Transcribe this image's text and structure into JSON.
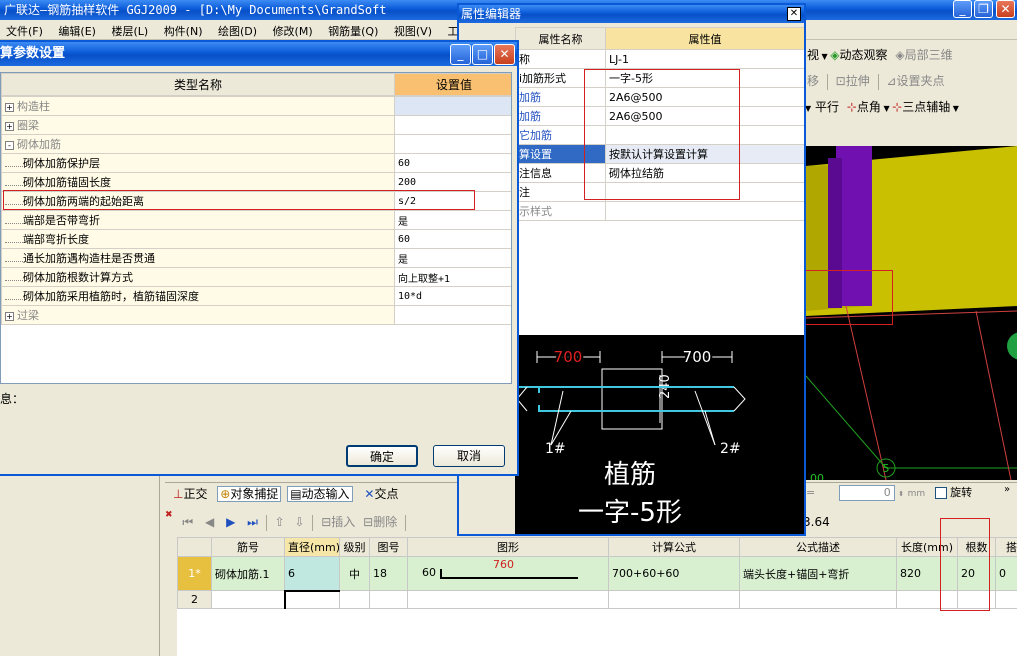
{
  "app": {
    "title": "广联达—钢筋抽样软件 GGJ2009 - [D:\\My Documents\\GrandSoft",
    "menus": [
      "文件(F)",
      "编辑(E)",
      "楼层(L)",
      "构件(N)",
      "绘图(D)",
      "修改(M)",
      "钢筋量(Q)",
      "视图(V)",
      "工具"
    ]
  },
  "toolbar_right": {
    "row1": [
      "视",
      "动态观察",
      "局部三维"
    ],
    "row2": [
      "移",
      "拉伸",
      "设置夹点"
    ],
    "row3": [
      "平行",
      "点角",
      "三点辅轴"
    ]
  },
  "calc_dialog": {
    "title": "算参数设置",
    "headers": {
      "name": "类型名称",
      "value": "设置值"
    },
    "rows": [
      {
        "expander": "+",
        "name": "构造柱",
        "value": "",
        "group": true
      },
      {
        "expander": "+",
        "name": "圈梁",
        "value": "",
        "group": true
      },
      {
        "expander": "-",
        "name": "砌体加筋",
        "value": "",
        "group": true
      },
      {
        "expander": "",
        "name": "砌体加筋保护层",
        "value": "60",
        "group": false
      },
      {
        "expander": "",
        "name": "砌体加筋锚固长度",
        "value": "200",
        "group": false
      },
      {
        "expander": "",
        "name": "砌体加筋两端的起始距离",
        "value": "s/2",
        "group": false
      },
      {
        "expander": "",
        "name": "端部是否带弯折",
        "value": "是",
        "group": false
      },
      {
        "expander": "",
        "name": "端部弯折长度",
        "value": "60",
        "group": false
      },
      {
        "expander": "",
        "name": "通长加筋遇构造柱是否贯通",
        "value": "是",
        "group": false
      },
      {
        "expander": "",
        "name": "砌体加筋根数计算方式",
        "value": "向上取整+1",
        "group": false
      },
      {
        "expander": "",
        "name": "砌体加筋采用植筋时，植筋锚固深度",
        "value": "10*d",
        "group": false
      },
      {
        "expander": "+",
        "name": "过梁",
        "value": "",
        "group": true
      }
    ],
    "info_label": "息：",
    "ok": "确定",
    "cancel": "取消"
  },
  "prop_editor": {
    "title": "属性编辑器",
    "headers": {
      "name": "属性名称",
      "value": "属性值"
    },
    "rows": [
      {
        "name": "称",
        "value": "LJ-1"
      },
      {
        "name": "i加筋形式",
        "value": "一字-5形"
      },
      {
        "name": "加筋",
        "value": "2A6@500"
      },
      {
        "name": "加筋",
        "value": "2A6@500"
      },
      {
        "name": "它加筋",
        "value": ""
      },
      {
        "name": "算设置",
        "value": "按默认计算设置计算"
      },
      {
        "name": "注信息",
        "value": "砌体拉结筋"
      },
      {
        "name": "注",
        "value": ""
      },
      {
        "name": "示样式",
        "value": ""
      }
    ]
  },
  "diagram": {
    "dim_left": "700",
    "dim_right": "700",
    "wall": "240",
    "label1": "1#",
    "label2": "2#",
    "caption1": "植筋",
    "caption2": "一字-5形"
  },
  "bottom_toolbar": {
    "ortho": "正交",
    "snap": "对象捕捉",
    "dyn": "动态输入",
    "intersect": "交点",
    "rotate_value": "0",
    "rotate_unit": "mm",
    "rotate": "旋转",
    "insert": "插入",
    "delete": "删除",
    "len": "3.64"
  },
  "rebar_table": {
    "headers": [
      "",
      "筋号",
      "直径(mm)",
      "级别",
      "图号",
      "图形",
      "计算公式",
      "公式描述",
      "长度(mm)",
      "根数",
      "搭"
    ],
    "rows": [
      {
        "idx": "1*",
        "name": "砌体加筋.1",
        "dia": "6",
        "grade": "中",
        "fig": "18",
        "shape_left": "60",
        "shape_len": "760",
        "formula": "700+60+60",
        "desc": "端头长度+锚固+弯折",
        "length": "820",
        "count": "20",
        "lap": "0"
      },
      {
        "idx": "2",
        "name": "",
        "dia": "",
        "grade": "",
        "fig": "",
        "shape_left": "",
        "shape_len": "",
        "formula": "",
        "desc": "",
        "length": "",
        "count": "",
        "lap": ""
      }
    ]
  },
  "viewport": {
    "axis_label": "5",
    "axis_num": "00",
    "axis_num2": "000"
  }
}
